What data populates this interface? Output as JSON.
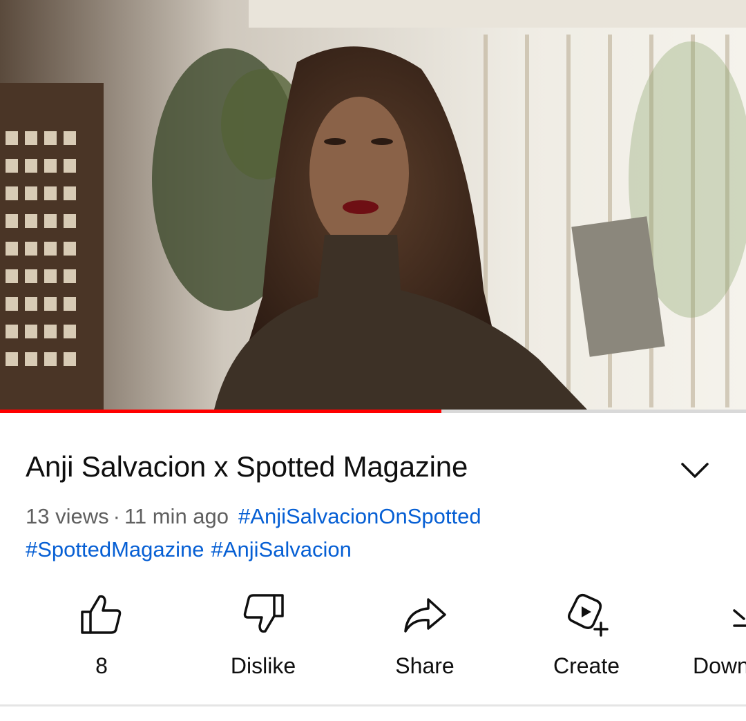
{
  "video": {
    "progress_fraction": 0.592
  },
  "meta": {
    "title": "Anji Salvacion x Spotted Magazine",
    "views": "13 views",
    "separator": "·",
    "age": "11 min ago",
    "hashtags": [
      "#AnjiSalvacionOnSpotted",
      "#SpottedMagazine",
      "#AnjiSalvacion"
    ]
  },
  "actions": {
    "like": {
      "label": "8",
      "icon": "thumbs-up-icon"
    },
    "dislike": {
      "label": "Dislike",
      "icon": "thumbs-down-icon"
    },
    "share": {
      "label": "Share",
      "icon": "share-icon"
    },
    "create": {
      "label": "Create",
      "icon": "create-icon"
    },
    "download": {
      "label": "Down",
      "icon": "download-icon"
    }
  },
  "colors": {
    "progress": "#ff0000",
    "hashtag": "#065fd4",
    "text": "#0f0f0f",
    "meta": "#606060"
  }
}
